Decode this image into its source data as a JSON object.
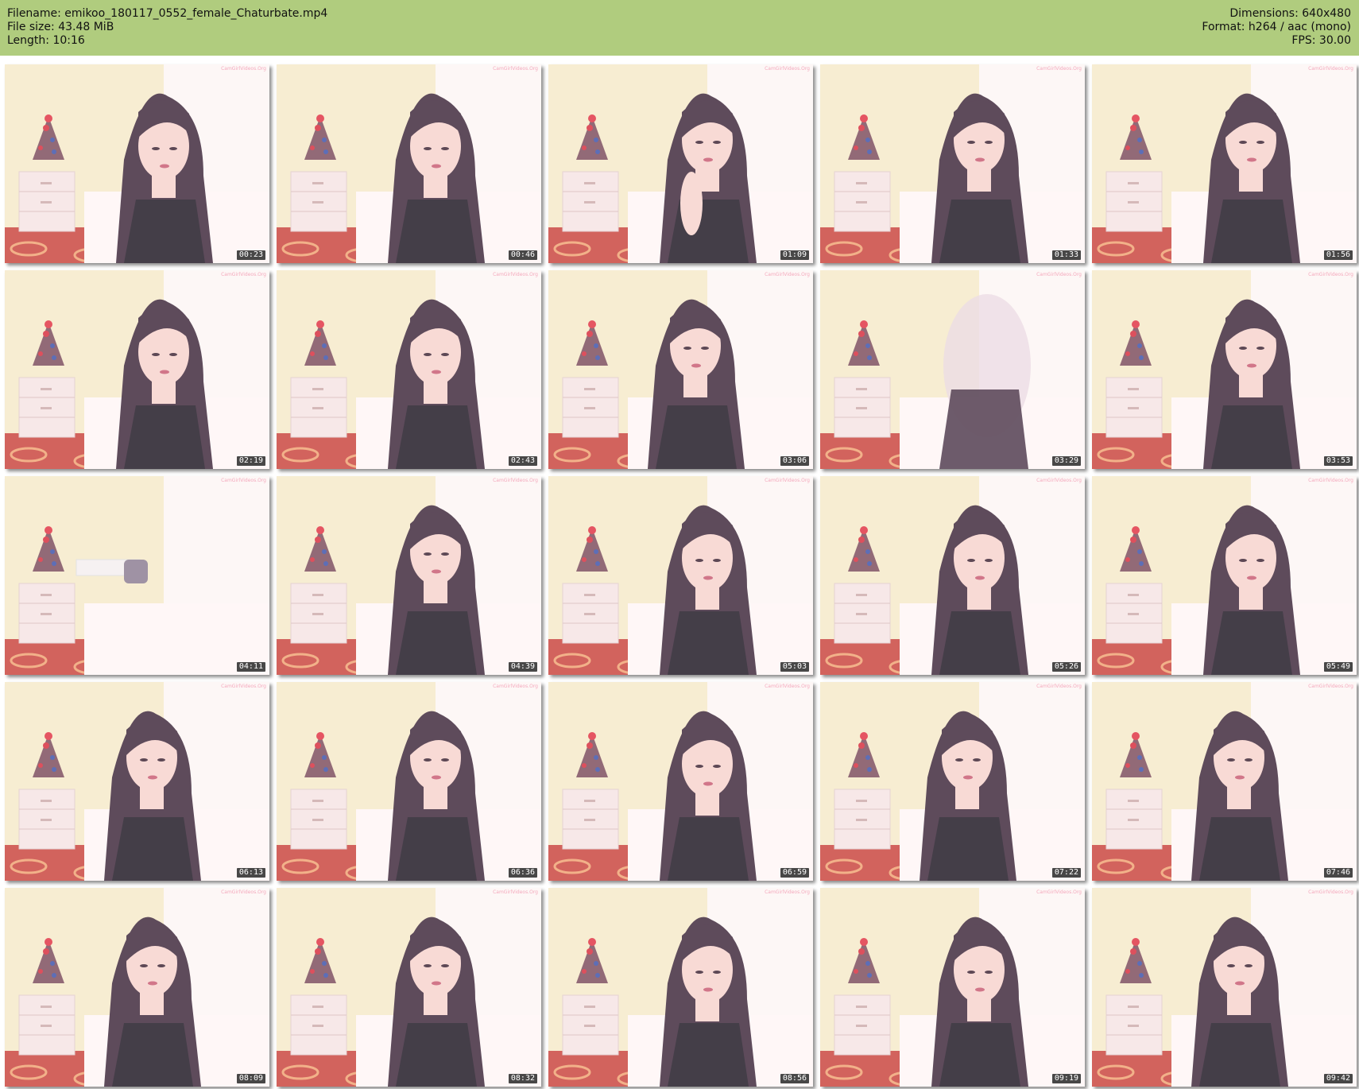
{
  "header": {
    "filename_line": "Filename: emikoo_180117_0552_female_Chaturbate.mp4",
    "filesize_line": "File size: 43.48 MiB",
    "length_line": "Length: 10:16",
    "dimensions_line": "Dimensions: 640x480",
    "format_line": "Format: h264 / aac (mono)",
    "fps_line": "FPS: 30.00",
    "background_color": "#b0cc7e"
  },
  "thumbnails": [
    {
      "time": "00:23",
      "pose": "face-down"
    },
    {
      "time": "00:46",
      "pose": "face-down"
    },
    {
      "time": "01:09",
      "pose": "hand-on-cheek"
    },
    {
      "time": "01:33",
      "pose": "face-front"
    },
    {
      "time": "01:56",
      "pose": "face-front"
    },
    {
      "time": "02:19",
      "pose": "face-down"
    },
    {
      "time": "02:43",
      "pose": "face-down"
    },
    {
      "time": "03:06",
      "pose": "face-side"
    },
    {
      "time": "03:29",
      "pose": "blurred"
    },
    {
      "time": "03:53",
      "pose": "face-front"
    },
    {
      "time": "04:11",
      "pose": "empty"
    },
    {
      "time": "04:39",
      "pose": "face-front"
    },
    {
      "time": "05:03",
      "pose": "face-down"
    },
    {
      "time": "05:26",
      "pose": "face-down"
    },
    {
      "time": "05:49",
      "pose": "face-down"
    },
    {
      "time": "06:13",
      "pose": "face-side"
    },
    {
      "time": "06:36",
      "pose": "face-front"
    },
    {
      "time": "06:59",
      "pose": "face-down"
    },
    {
      "time": "07:22",
      "pose": "face-side"
    },
    {
      "time": "07:46",
      "pose": "face-side"
    },
    {
      "time": "08:09",
      "pose": "face-side"
    },
    {
      "time": "08:32",
      "pose": "face-front"
    },
    {
      "time": "08:56",
      "pose": "face-down"
    },
    {
      "time": "09:19",
      "pose": "face-down"
    },
    {
      "time": "09:42",
      "pose": "face-side"
    }
  ],
  "watermark_text": "CamGirlVideos.Org",
  "colors": {
    "wall": "#f6e9c8",
    "floor": "#c8413a",
    "skin": "#f7d2cc",
    "hair": "#3b2438",
    "nightstand": "#f6e3e3",
    "stamp_bg": "#282828"
  }
}
